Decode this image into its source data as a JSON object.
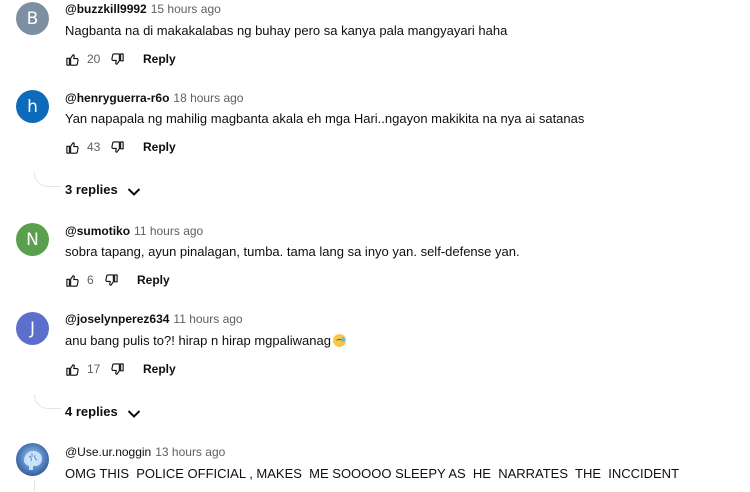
{
  "icons": {
    "like": "thumbs-up-icon",
    "dislike": "thumbs-down-icon",
    "expand": "chevron-down-icon"
  },
  "colors": {
    "avatar_b": "#7d8fa0",
    "avatar_h": "#0d6bba",
    "avatar_n": "#59a04c",
    "avatar_j": "#5d6fcc",
    "avatar_photo": "#4b79b8"
  },
  "comments": [
    {
      "initial": "B",
      "author": "@buzzkill9992",
      "time": "15 hours ago",
      "text": "Nagbanta na di makakalabas ng buhay pero sa kanya pala mangyayari haha",
      "likes": "20",
      "reply_label": "Reply"
    },
    {
      "initial": "h",
      "author": "@henryguerra-r6o",
      "time": "18 hours ago",
      "text": "Yan napapala ng mahilig magbanta akala eh mga Hari..ngayon makikita na nya ai satanas",
      "likes": "43",
      "reply_label": "Reply",
      "replies_label": "3 replies"
    },
    {
      "initial": "N",
      "author": "@sumotiko",
      "time": "11 hours ago",
      "text": "sobra tapang, ayun pinalagan, tumba. tama lang sa inyo yan. self-defense yan.",
      "likes": "6",
      "reply_label": "Reply"
    },
    {
      "initial": "J",
      "author": "@joselynperez634",
      "time": "11 hours ago",
      "text": "anu bang pulis to?! hirap n hirap mgpaliwanag",
      "likes": "17",
      "reply_label": "Reply",
      "replies_label": "4 replies"
    },
    {
      "author": "@Use.ur.noggin",
      "time": "13 hours ago",
      "text": "OMG THIS  POLICE OFFICIAL , MAKES  ME SOOOOO SLEEPY AS  HE  NARRATES  THE  INCCIDENT"
    }
  ]
}
